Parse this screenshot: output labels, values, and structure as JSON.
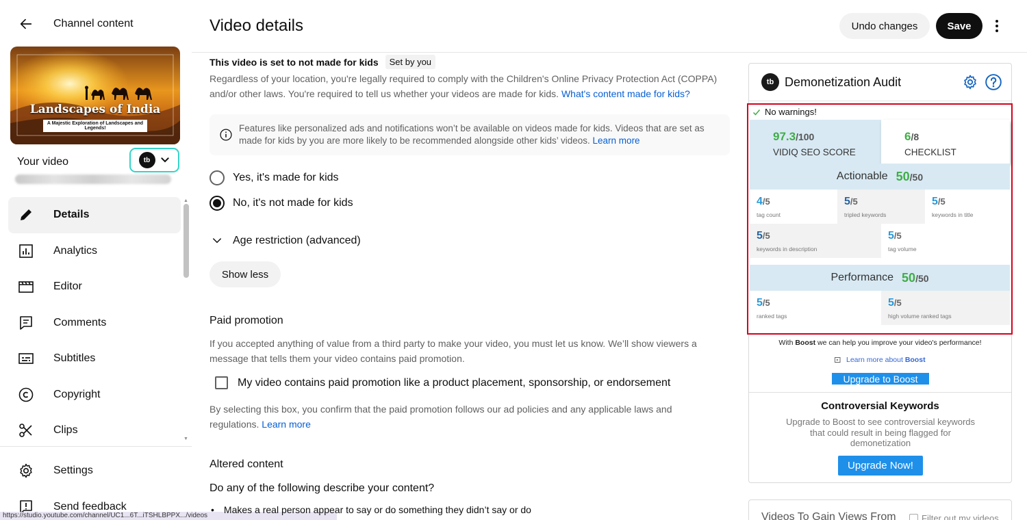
{
  "sidebar": {
    "header_title": "Channel content",
    "thumbnail": {
      "title": "Landscapes of India",
      "subtitle": "A Majestic Exploration of Landscapes and Legends!"
    },
    "your_video_label": "Your video",
    "tb_badge": "tb",
    "nav": [
      {
        "label": "Details",
        "icon": "pencil-icon",
        "active": true
      },
      {
        "label": "Analytics",
        "icon": "analytics-icon"
      },
      {
        "label": "Editor",
        "icon": "clapperboard-icon"
      },
      {
        "label": "Comments",
        "icon": "comment-icon"
      },
      {
        "label": "Subtitles",
        "icon": "subtitles-icon"
      },
      {
        "label": "Copyright",
        "icon": "copyright-icon"
      },
      {
        "label": "Clips",
        "icon": "scissors-icon"
      }
    ],
    "bottom_nav": [
      {
        "label": "Settings",
        "icon": "gear-icon"
      },
      {
        "label": "Send feedback",
        "icon": "feedback-icon"
      }
    ],
    "status_url": "https://studio.youtube.com/channel/UC1...6T...iTSHLBPPX.../videos"
  },
  "header": {
    "title": "Video details",
    "undo_label": "Undo changes",
    "save_label": "Save"
  },
  "kids": {
    "title": "This video is set to not made for kids",
    "chip": "Set by you",
    "paragraph": "Regardless of your location, you're legally required to comply with the Children's Online Privacy Protection Act (COPPA) and/or other laws. You're required to tell us whether your videos are made for kids.",
    "paragraph_link": "What's content made for kids?",
    "info": "Features like personalized ads and notifications won’t be available on videos made for kids. Videos that are set as made for kids by you are more likely to be recommended alongside other kids’ videos.",
    "info_link": "Learn more",
    "option_yes": "Yes, it's made for kids",
    "option_no": "No, it's not made for kids",
    "selected": "no"
  },
  "age_restriction": {
    "label": "Age restriction (advanced)"
  },
  "show_less_label": "Show less",
  "paid_promotion": {
    "title": "Paid promotion",
    "text": "If you accepted anything of value from a third party to make your video, you must let us know. We’ll show viewers a message that tells them your video contains paid promotion.",
    "checkbox_label": "My video contains paid promotion like a product placement, sponsorship, or endorsement",
    "checked": false,
    "note": "By selecting this box, you confirm that the paid promotion follows our ad policies and any applicable laws and regulations.",
    "note_link": "Learn more"
  },
  "altered": {
    "title": "Altered content",
    "question": "Do any of the following describe your content?",
    "bullet": "Makes a real person appear to say or do something they didn’t say or do"
  },
  "panel": {
    "logo": "tb",
    "title": "Demonetization Audit",
    "no_warnings": "No warnings!",
    "seo_score": "97.3",
    "seo_denom": "/100",
    "seo_label": "VIDIQ SEO SCORE",
    "checklist_score": "6",
    "checklist_denom": "/8",
    "checklist_label": "CHECKLIST",
    "actionable_label": "Actionable",
    "actionable_score": "50",
    "actionable_denom": "/50",
    "actionable_items": [
      {
        "value": "4",
        "denom": "/5",
        "caption": "tag count"
      },
      {
        "value": "5",
        "denom": "/5",
        "caption": "tripled keywords"
      },
      {
        "value": "5",
        "denom": "/5",
        "caption": "keywords in title"
      },
      {
        "value": "5",
        "denom": "/5",
        "caption": "keywords in description"
      },
      {
        "value": "5",
        "denom": "/5",
        "caption": "tag volume"
      }
    ],
    "performance_label": "Performance",
    "performance_score": "50",
    "performance_denom": "/50",
    "performance_items": [
      {
        "value": "5",
        "denom": "/5",
        "caption": "ranked tags"
      },
      {
        "value": "5",
        "denom": "/5",
        "caption": "high volume ranked tags"
      }
    ],
    "boost_text_pre": "With ",
    "boost_text_bold": "Boost",
    "boost_text_post": " we can help you improve your video's performance!",
    "boost_link_pre": "Learn more about ",
    "boost_link_bold": "Boost",
    "upgrade_boost_label": "Upgrade to Boost",
    "controversial_title": "Controversial Keywords",
    "controversial_text": "Upgrade to Boost to see controversial keywords that could result in being flagged for demonetization",
    "upgrade_now_label": "Upgrade Now!"
  },
  "panel2": {
    "title": "Videos To Gain Views From",
    "filter_label": "Filter out my videos"
  },
  "colors": {
    "accent_blue": "#065fd4",
    "score_green": "#3fad46",
    "highlight_red": "#d6001c",
    "tile_blue": "#d8e9f3",
    "boost_button": "#1e90ea",
    "tb_border": "#34d3c9"
  }
}
